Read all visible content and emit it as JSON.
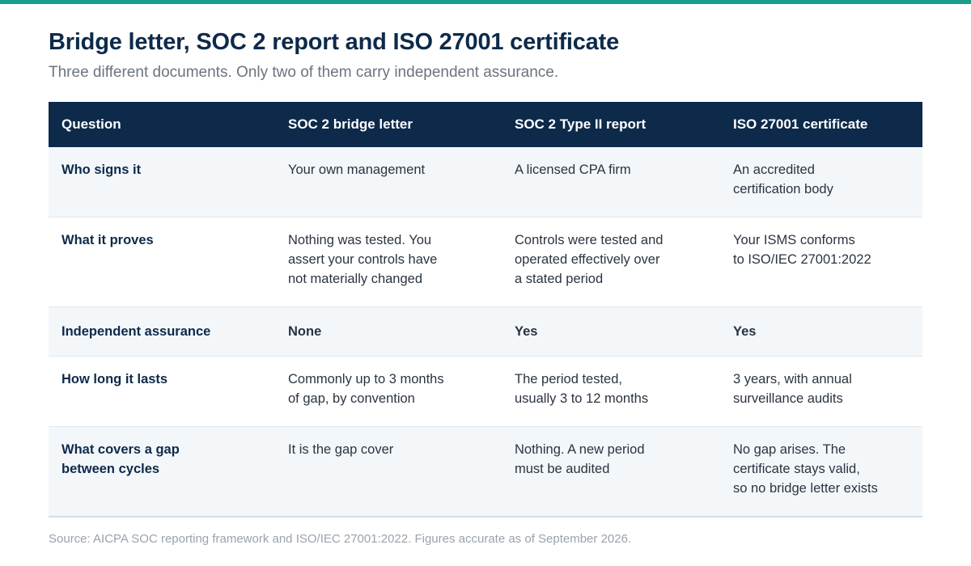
{
  "title": "Bridge letter, SOC 2 report and ISO 27001 certificate",
  "subtitle": "Three different documents. Only two of them carry independent assurance.",
  "colors": {
    "accent": "#1a9c8c",
    "header_bg": "#0d2a4a",
    "none": "#7a4de0",
    "yes": "#1a9c8c"
  },
  "table": {
    "headers": [
      "Question",
      "SOC 2 bridge letter",
      "SOC 2 Type II report",
      "ISO 27001 certificate"
    ],
    "rows": [
      {
        "question": "Who signs it",
        "bridge": "Your own management",
        "soc2": "A licensed CPA firm",
        "iso": "An accredited\ncertification body"
      },
      {
        "question": "What it proves",
        "bridge": "Nothing was tested. You\nassert your controls have\nnot materially changed",
        "soc2": "Controls were tested and\noperated effectively over\na stated period",
        "iso": "Your ISMS conforms\nto ISO/IEC 27001:2022"
      },
      {
        "question": "Independent assurance",
        "bridge": "None",
        "soc2": "Yes",
        "iso": "Yes"
      },
      {
        "question": "How long it lasts",
        "bridge": "Commonly up to 3 months\nof gap, by convention",
        "soc2": "The period tested,\nusually 3 to 12 months",
        "iso": "3 years, with annual\nsurveillance audits"
      },
      {
        "question": "What covers a gap\nbetween cycles",
        "bridge": "It is the gap cover",
        "soc2": "Nothing. A new period\nmust be audited",
        "iso": "No gap arises. The\ncertificate stays valid,\nso no bridge letter exists"
      }
    ]
  },
  "source": "Source: AICPA SOC reporting framework and ISO/IEC 27001:2022. Figures accurate as of September 2026."
}
